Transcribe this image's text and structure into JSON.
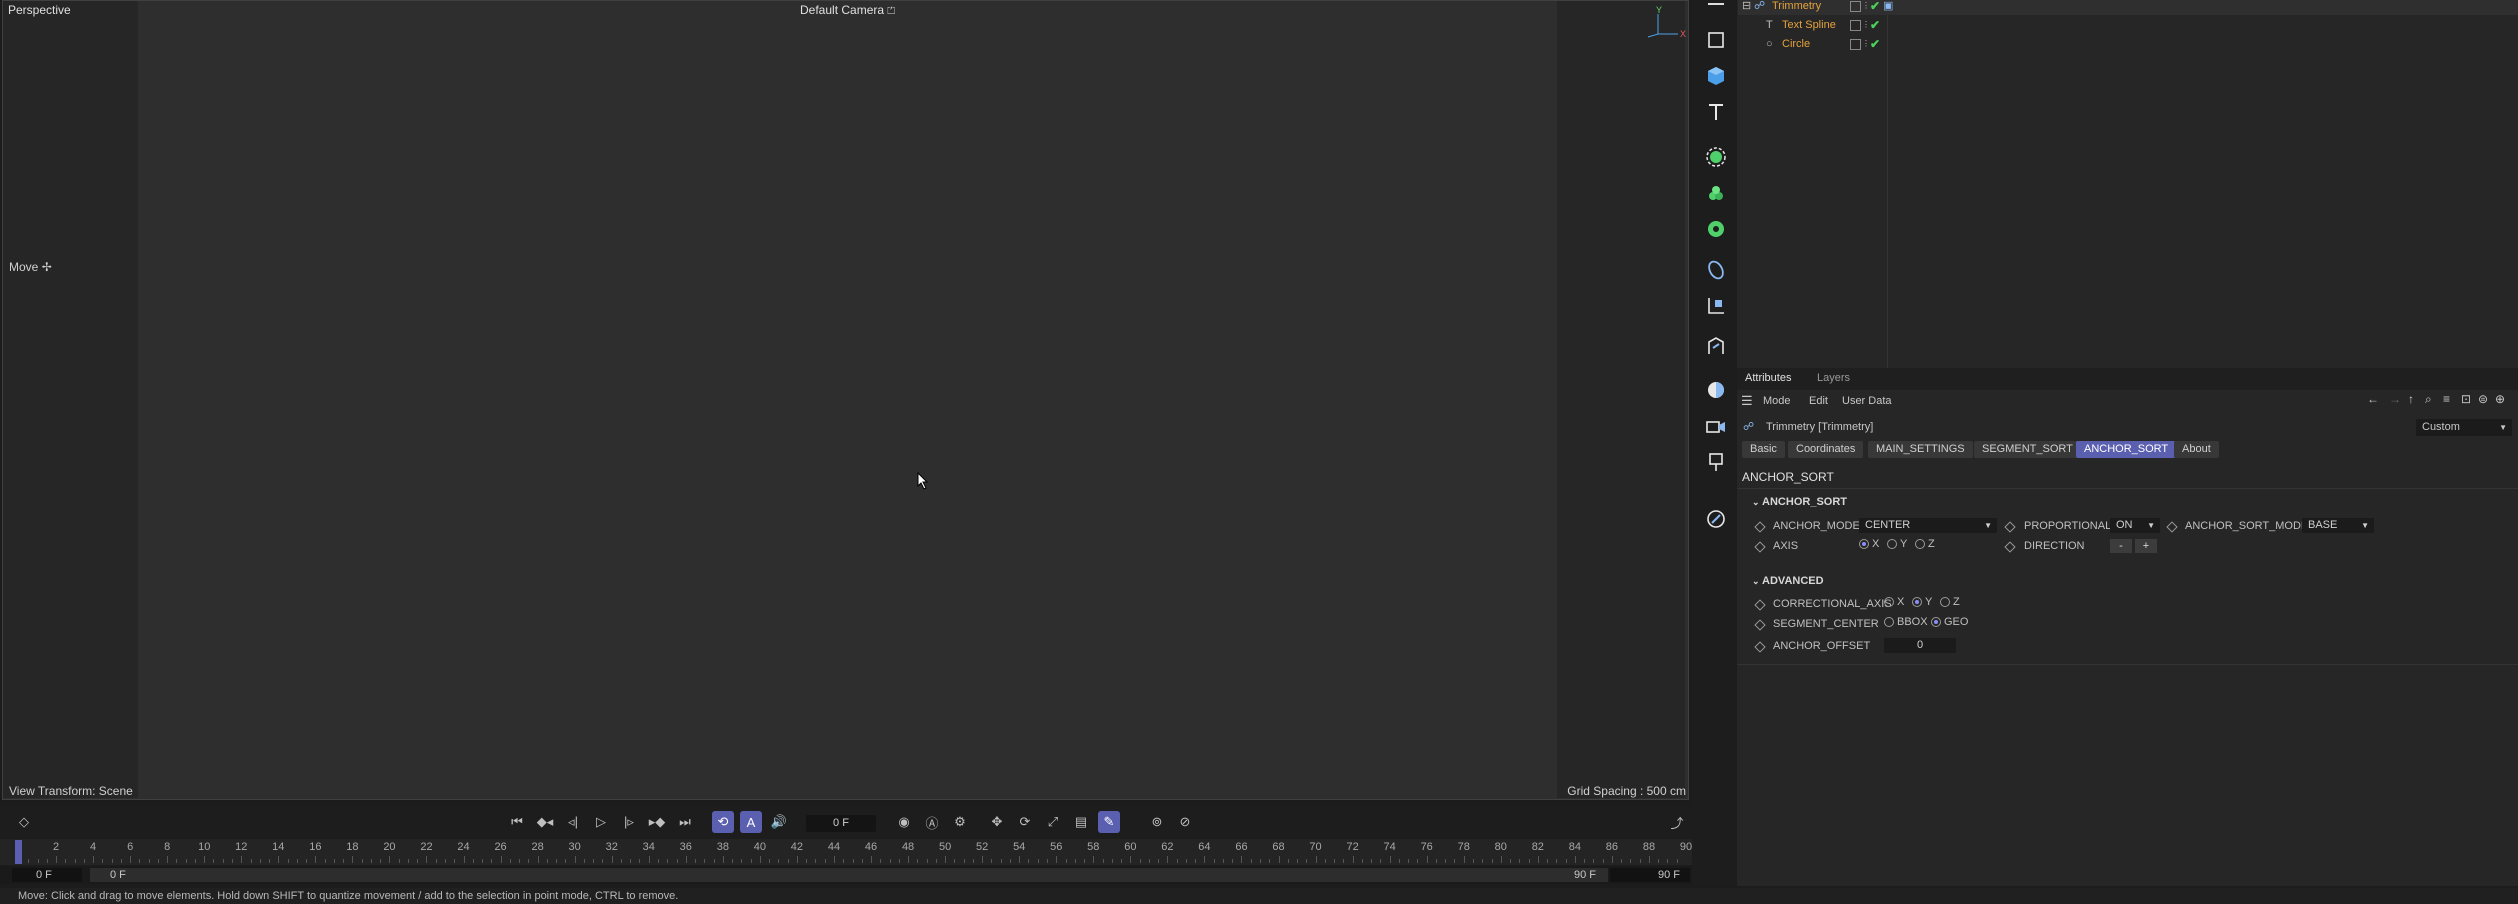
{
  "viewport": {
    "title": "Perspective",
    "camera": "Default Camera",
    "camera_icon": "camera-lock-icon",
    "tool_label": "Move",
    "view_transform": "View Transform: Scene",
    "grid_spacing": "Grid Spacing : 500 cm",
    "axis_labels": {
      "y": "Y",
      "x": "X"
    }
  },
  "timeline": {
    "current_frame": "0 F",
    "ticks": [
      "0",
      "2",
      "4",
      "6",
      "8",
      "10",
      "12",
      "14",
      "16",
      "18",
      "20",
      "22",
      "24",
      "26",
      "28",
      "30",
      "32",
      "34",
      "36",
      "38",
      "40",
      "42",
      "44",
      "46",
      "48",
      "50",
      "52",
      "54",
      "56",
      "58",
      "60",
      "62",
      "64",
      "66",
      "68",
      "70",
      "72",
      "74",
      "76",
      "78",
      "80",
      "82",
      "84",
      "86",
      "88",
      "90"
    ],
    "range_start": "0 F",
    "range_slider_start": "0 F",
    "range_slider_end": "90 F",
    "range_end": "90 F",
    "auto_key_label": "A",
    "accent_color": "#5b5fb0"
  },
  "status": {
    "text": "Move: Click and drag to move elements. Hold down SHIFT to quantize movement / add to the selection in point mode, CTRL to remove."
  },
  "objects": [
    {
      "name": "Trimmetry",
      "icon": "trimmetry-icon",
      "level": 0
    },
    {
      "name": "Text Spline",
      "icon": "text-spline-icon",
      "level": 1
    },
    {
      "name": "Circle",
      "icon": "circle-icon",
      "level": 1
    }
  ],
  "attributes": {
    "tabs": [
      "Attributes",
      "Layers"
    ],
    "menu": [
      "Mode",
      "Edit",
      "User Data"
    ],
    "object_title": "Trimmetry [Trimmetry]",
    "preset": "Custom",
    "page_tabs": [
      "Basic",
      "Coordinates",
      "MAIN_SETTINGS",
      "SEGMENT_SORT",
      "ANCHOR_SORT",
      "About"
    ],
    "active_tab": "ANCHOR_SORT",
    "page_heading": "ANCHOR_SORT",
    "anchor_sort": {
      "section": "ANCHOR_SORT",
      "anchor_mode_label": "ANCHOR_MODE",
      "anchor_mode_value": "CENTER",
      "proportional_label": "PROPORTIONAL",
      "proportional_value": "ON",
      "anchor_sort_mode_label": "ANCHOR_SORT_MODE",
      "anchor_sort_mode_value": "BASE",
      "axis_label": "AXIS",
      "axis_options": [
        "X",
        "Y",
        "Z"
      ],
      "axis_selected": "X",
      "direction_label": "DIRECTION",
      "direction_minus": "-",
      "direction_plus": "+"
    },
    "advanced": {
      "section": "ADVANCED",
      "correctional_axis_label": "CORRECTIONAL_AXIS",
      "correctional_axis_options": [
        "X",
        "Y",
        "Z"
      ],
      "correctional_axis_selected": "Y",
      "segment_center_label": "SEGMENT_CENTER",
      "segment_center_options": [
        "BBOX",
        "GEO"
      ],
      "segment_center_selected": "GEO",
      "anchor_offset_label": "ANCHOR_OFFSET",
      "anchor_offset_value": "0"
    }
  }
}
